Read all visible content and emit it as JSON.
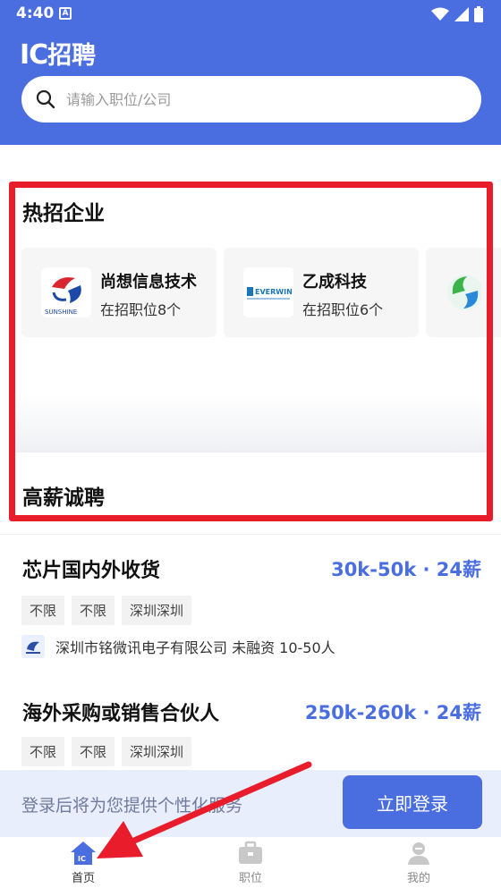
{
  "status": {
    "time": "4:40",
    "notif": "A"
  },
  "header": {
    "logo_ic": "IC",
    "logo_text": "招聘"
  },
  "search": {
    "placeholder": "请输入职位/公司"
  },
  "sections": {
    "hot_title": "热招企业",
    "high_title": "高薪诚聘"
  },
  "companies": [
    {
      "name": "尚想信息技术",
      "count": "在招职位8个",
      "logo_text": "SUNSHINE"
    },
    {
      "name": "乙成科技",
      "count": "在招职位6个",
      "logo_text": "EVERWIN"
    }
  ],
  "jobs": [
    {
      "title": "芯片国内外收货",
      "salary": "30k-50k · 24薪",
      "tags": [
        "不限",
        "不限",
        "深圳深圳"
      ],
      "company": "深圳市铭微讯电子有限公司 未融资 10-50人"
    },
    {
      "title": "海外采购或销售合伙人",
      "salary": "250k-260k · 24薪",
      "tags": [
        "不限",
        "不限",
        "深圳深圳"
      ]
    }
  ],
  "login": {
    "text": "登录后将为您提供个性化服务",
    "button": "立即登录"
  },
  "tabs": [
    {
      "label": "首页"
    },
    {
      "label": "职位"
    },
    {
      "label": "我的"
    }
  ],
  "colors": {
    "brand": "#4a6ee0",
    "highlight": "#e81c2a",
    "arrow": "#e81c2a"
  }
}
